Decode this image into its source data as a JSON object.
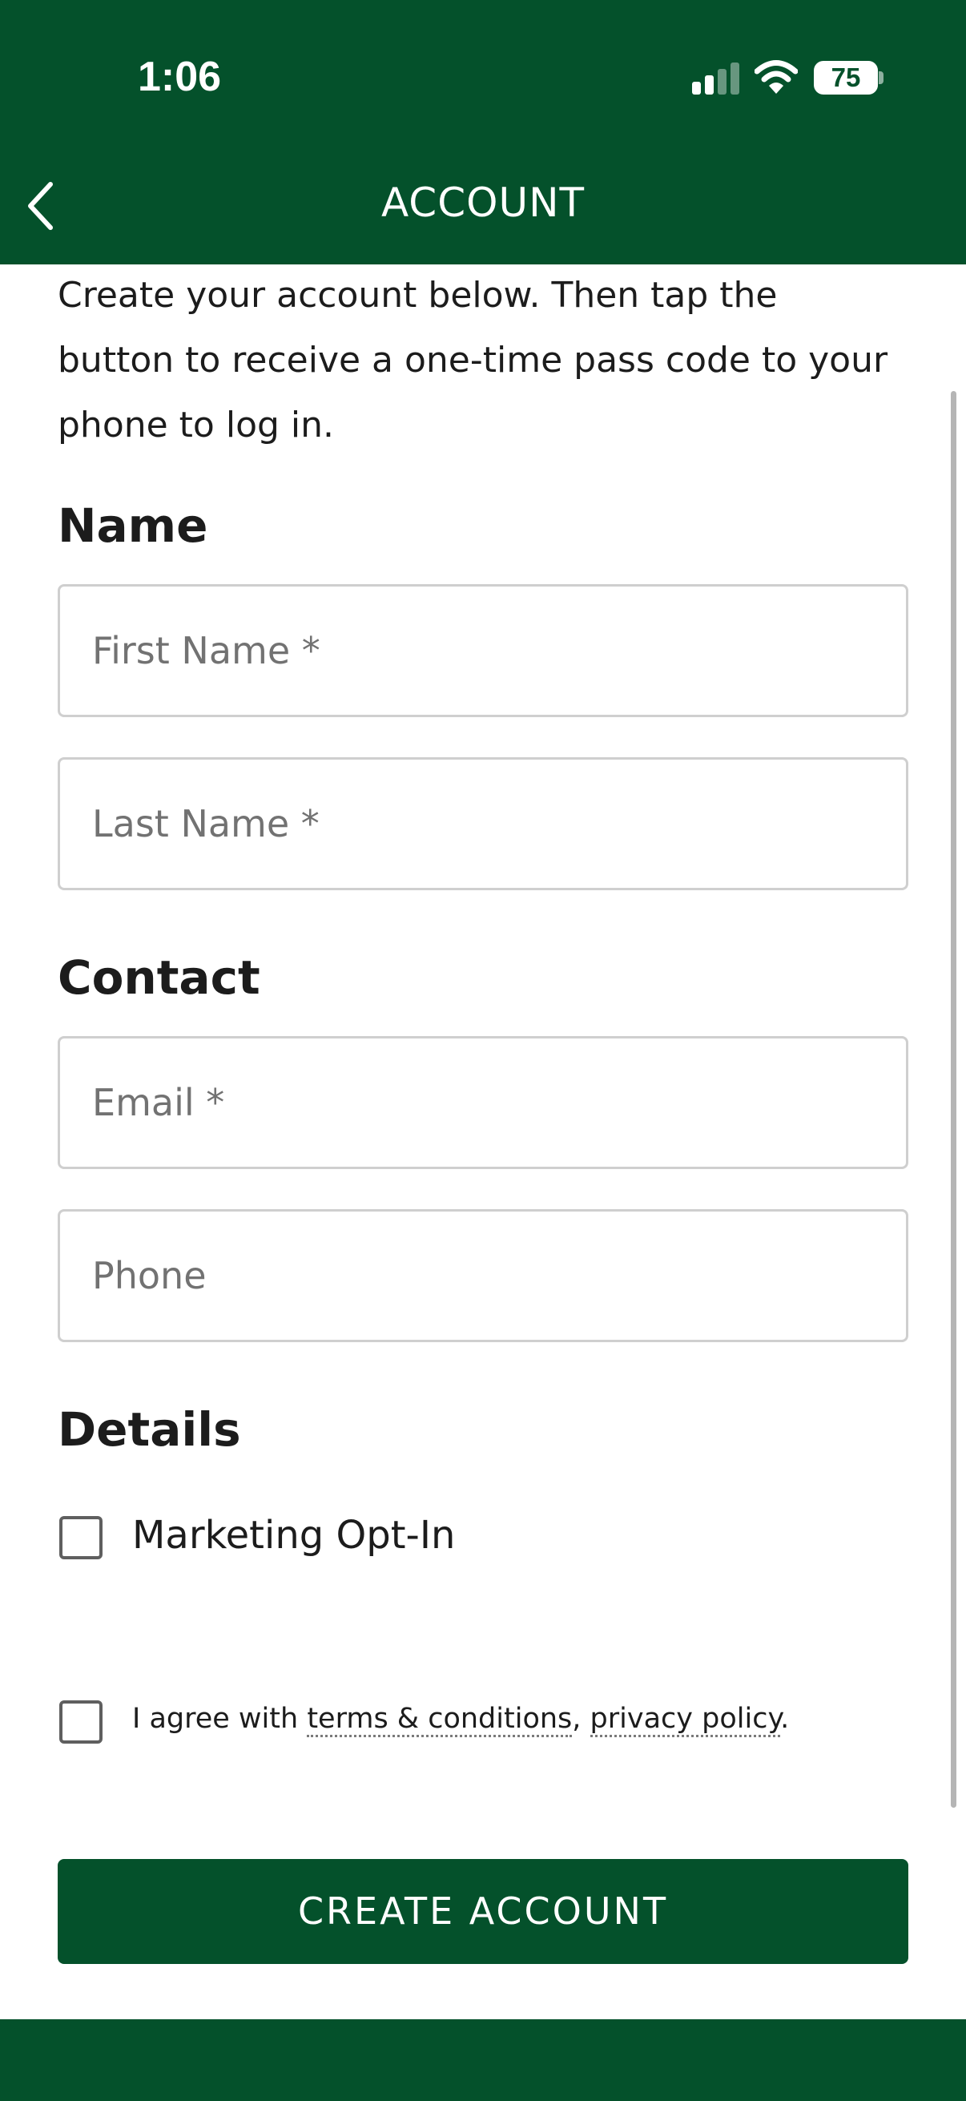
{
  "status_bar": {
    "time": "1:06",
    "battery": "75",
    "signal_bars_active": 2,
    "signal_bars_total": 4
  },
  "nav": {
    "title": "ACCOUNT",
    "back_icon": "chevron-left-icon"
  },
  "intro_text": "Create your account below. Then tap the button to receive a one-time pass code to your phone to log in.",
  "sections": {
    "name": {
      "heading": "Name",
      "first_name_placeholder": "First Name *",
      "last_name_placeholder": "Last Name *"
    },
    "contact": {
      "heading": "Contact",
      "email_placeholder": "Email *",
      "phone_placeholder": "Phone"
    },
    "details": {
      "heading": "Details",
      "marketing_label": "Marketing Opt-In"
    }
  },
  "agreement": {
    "prefix": "I agree with ",
    "terms_link": "terms & conditions",
    "separator": ", ",
    "privacy_link": "privacy policy",
    "suffix": "."
  },
  "create_button_label": "CREATE ACCOUNT",
  "colors": {
    "brand_green": "#04512b",
    "text": "#1c1c1c",
    "placeholder": "#727272",
    "border": "#cfcfcf"
  }
}
